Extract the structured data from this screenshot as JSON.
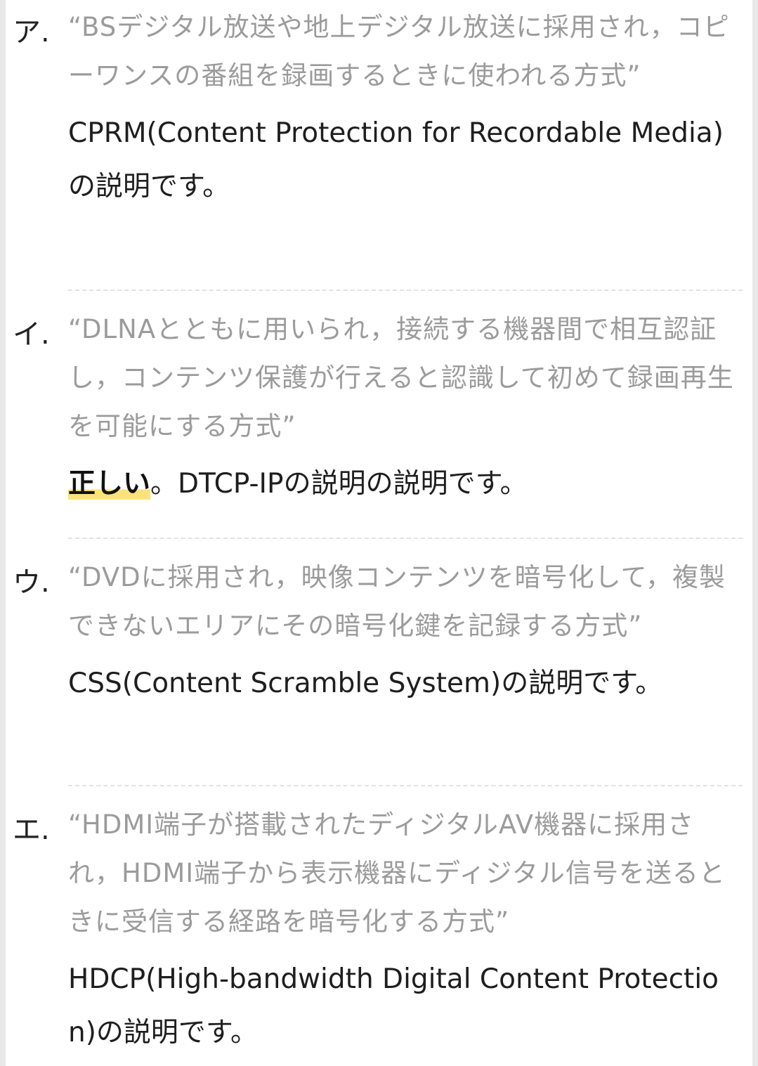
{
  "items": [
    {
      "label": "ア.",
      "question": "“BSデジタル放送や地上デジタル放送に採用され，コピーワンスの番組を録画するときに使われる方式”",
      "answer": "CPRM(Content Protection for Recordable Media)の説明です。"
    },
    {
      "label": "イ.",
      "question": "“DLNAとともに用いられ，接続する機器間で相互認証し，コンテンツ保護が行えると認識して初めて録画再生を可能にする方式”",
      "answer_mark": "正しい",
      "answer": "。DTCP-IPの説明の説明です。"
    },
    {
      "label": "ウ.",
      "question": "“DVDに採用され，映像コンテンツを暗号化して，複製できないエリアにその暗号化鍵を記録する方式”",
      "answer": "CSS(Content Scramble System)の説明です。"
    },
    {
      "label": "エ.",
      "question": "“HDMI端子が搭載されたディジタルAV機器に採用され，HDMI端子から表示機器にディジタル信号を送るときに受信する経路を暗号化する方式”",
      "answer": "HDCP(High-bandwidth Digital Content Protection)の説明です。"
    }
  ]
}
